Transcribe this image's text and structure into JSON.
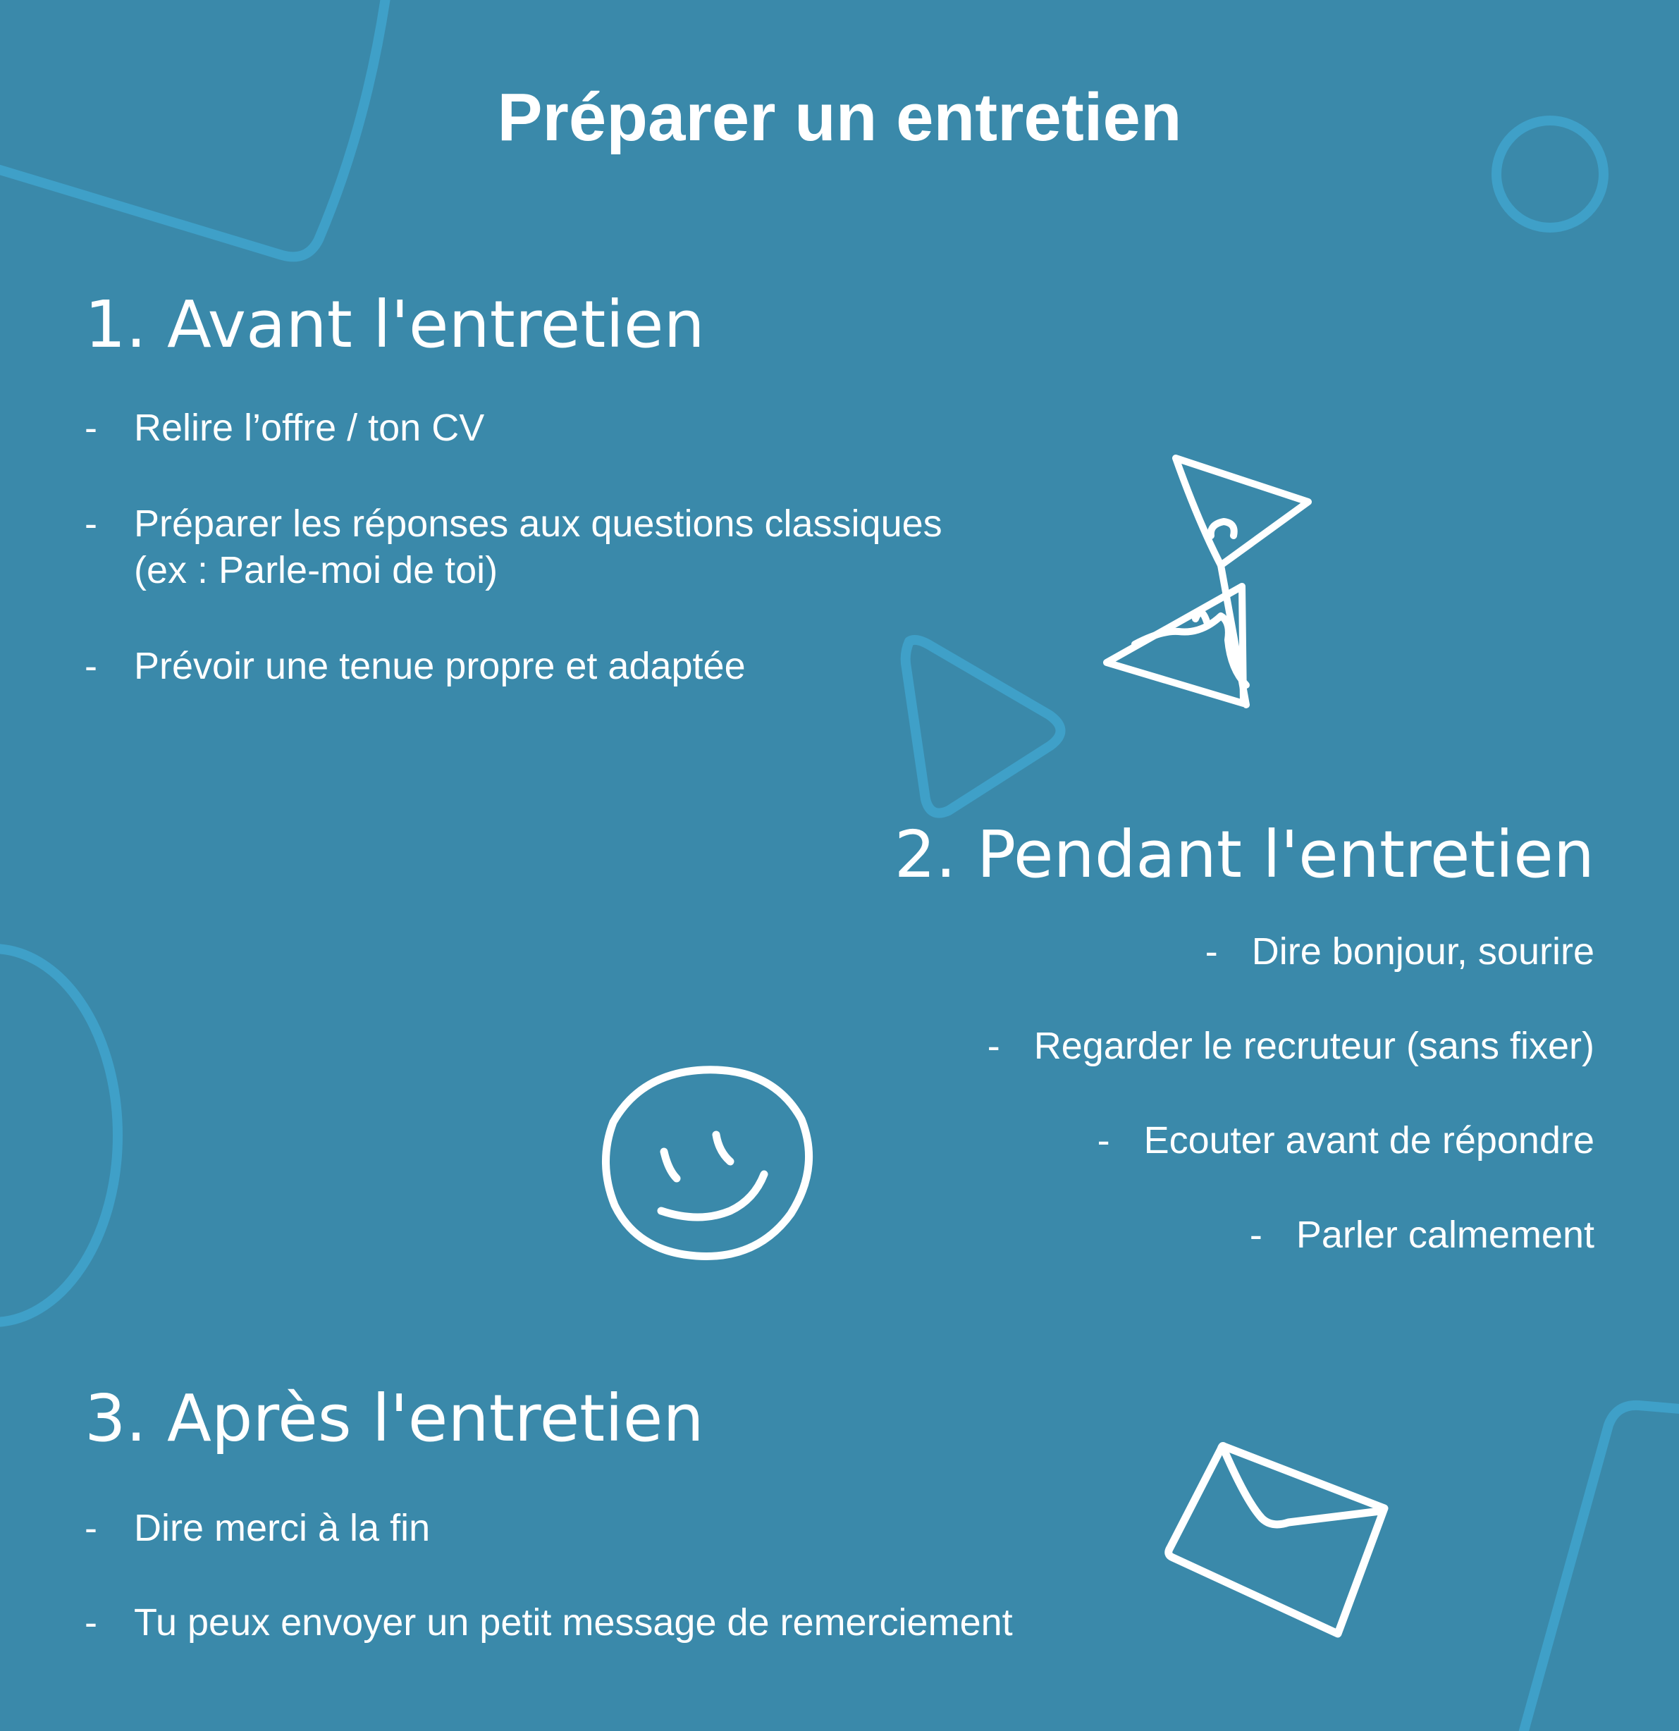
{
  "title": "Préparer un entretien",
  "colors": {
    "background": "#3a89aa",
    "decor_outline": "#3fa0c8",
    "text": "#ffffff"
  },
  "sections": [
    {
      "heading": "1. Avant l'entretien",
      "items": [
        {
          "bullet": "-",
          "text": "Relire l’offre / ton CV"
        },
        {
          "bullet": "-",
          "text": "Préparer les réponses aux questions classiques",
          "text2": "(ex : Parle-moi de toi)"
        },
        {
          "bullet": "-",
          "text": "Prévoir une tenue propre et adaptée"
        }
      ],
      "icon": "hourglass-icon"
    },
    {
      "heading": "2. Pendant l'entretien",
      "items": [
        {
          "bullet": "-",
          "text": "Dire bonjour, sourire"
        },
        {
          "bullet": "-",
          "text": "Regarder le recruteur (sans fixer)"
        },
        {
          "bullet": "-",
          "text": "Ecouter avant de répondre"
        },
        {
          "bullet": "-",
          "text": "Parler calmement"
        }
      ],
      "icon": "smiley-icon"
    },
    {
      "heading": "3. Après l'entretien",
      "items": [
        {
          "bullet": "-",
          "text": "Dire merci à la fin"
        },
        {
          "bullet": "-",
          "text": "Tu peux envoyer un petit message de remerciement"
        }
      ],
      "icon": "envelope-icon"
    }
  ]
}
